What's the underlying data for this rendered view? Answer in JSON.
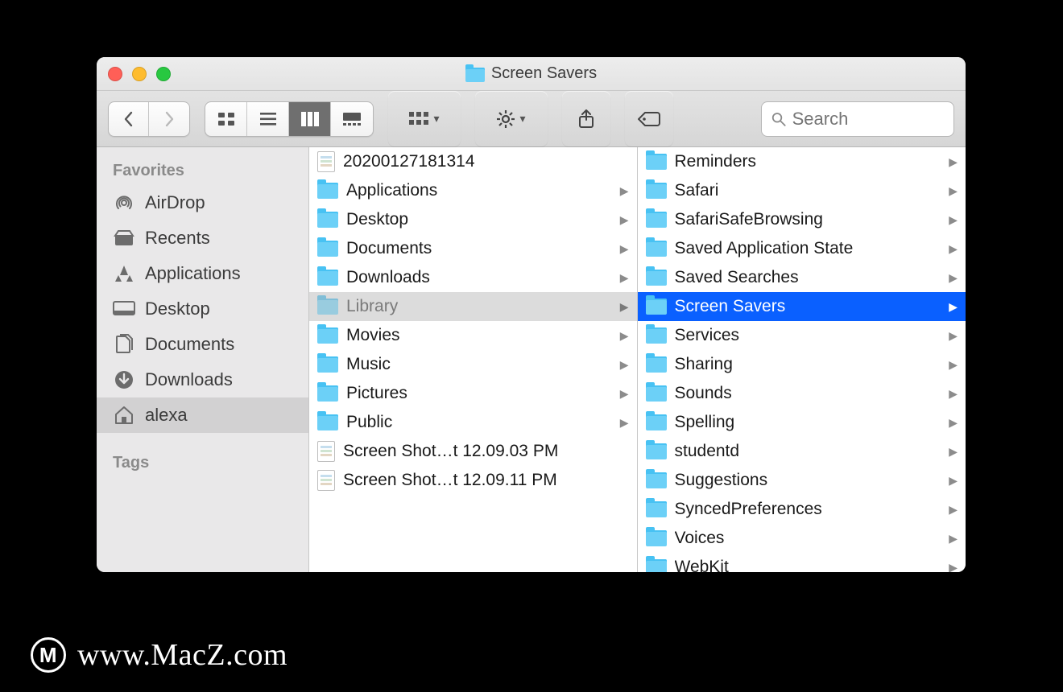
{
  "window": {
    "title": "Screen Savers"
  },
  "toolbar": {
    "search_placeholder": "Search"
  },
  "sidebar": {
    "sections": [
      {
        "title": "Favorites",
        "items": [
          {
            "icon": "airdrop",
            "label": "AirDrop"
          },
          {
            "icon": "recents",
            "label": "Recents"
          },
          {
            "icon": "applications",
            "label": "Applications"
          },
          {
            "icon": "desktop",
            "label": "Desktop"
          },
          {
            "icon": "documents",
            "label": "Documents"
          },
          {
            "icon": "downloads",
            "label": "Downloads"
          },
          {
            "icon": "home",
            "label": "alexa",
            "active": true
          }
        ]
      },
      {
        "title": "Tags",
        "items": []
      }
    ]
  },
  "columns": [
    [
      {
        "type": "file",
        "name": "20200127181314"
      },
      {
        "type": "folder",
        "name": "Applications"
      },
      {
        "type": "folder",
        "name": "Desktop"
      },
      {
        "type": "folder",
        "name": "Documents"
      },
      {
        "type": "folder",
        "name": "Downloads"
      },
      {
        "type": "folder",
        "name": "Library",
        "state": "dim"
      },
      {
        "type": "folder",
        "name": "Movies"
      },
      {
        "type": "folder",
        "name": "Music"
      },
      {
        "type": "folder",
        "name": "Pictures"
      },
      {
        "type": "folder",
        "name": "Public"
      },
      {
        "type": "file",
        "name": "Screen Shot…t 12.09.03 PM"
      },
      {
        "type": "file",
        "name": "Screen Shot…t 12.09.11 PM"
      }
    ],
    [
      {
        "type": "folder",
        "name": "Reminders"
      },
      {
        "type": "folder",
        "name": "Safari"
      },
      {
        "type": "folder",
        "name": "SafariSafeBrowsing"
      },
      {
        "type": "folder",
        "name": "Saved Application State"
      },
      {
        "type": "folder",
        "name": "Saved Searches"
      },
      {
        "type": "folder",
        "name": "Screen Savers",
        "state": "blue"
      },
      {
        "type": "folder",
        "name": "Services"
      },
      {
        "type": "folder",
        "name": "Sharing"
      },
      {
        "type": "folder",
        "name": "Sounds"
      },
      {
        "type": "folder",
        "name": "Spelling"
      },
      {
        "type": "folder",
        "name": "studentd"
      },
      {
        "type": "folder",
        "name": "Suggestions"
      },
      {
        "type": "folder",
        "name": "SyncedPreferences"
      },
      {
        "type": "folder",
        "name": "Voices"
      },
      {
        "type": "folder",
        "name": "WebKit"
      }
    ]
  ],
  "watermark": {
    "badge": "M",
    "text": "www.MacZ.com"
  }
}
